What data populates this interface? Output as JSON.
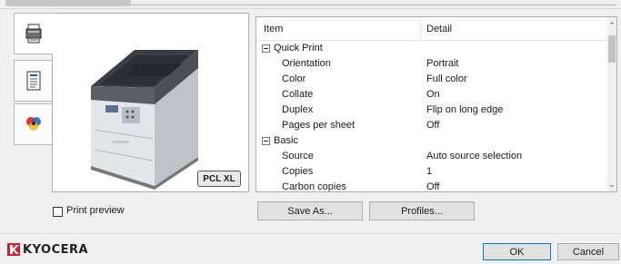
{
  "list": {
    "header_item": "Item",
    "header_detail": "Detail",
    "rows": [
      {
        "item": "Quick Print",
        "detail": "",
        "group": true
      },
      {
        "item": "Orientation",
        "detail": "Portrait"
      },
      {
        "item": "Color",
        "detail": "Full color"
      },
      {
        "item": "Collate",
        "detail": "On"
      },
      {
        "item": "Duplex",
        "detail": "Flip on long edge"
      },
      {
        "item": "Pages per sheet",
        "detail": "Off"
      },
      {
        "item": "Basic",
        "detail": "",
        "group": true
      },
      {
        "item": "Source",
        "detail": "Auto source selection"
      },
      {
        "item": "Copies",
        "detail": "1"
      },
      {
        "item": "Carbon copies",
        "detail": "Off"
      }
    ]
  },
  "preview": {
    "badge": "PCL XL"
  },
  "print_preview": {
    "label": "Print preview",
    "checked": false
  },
  "buttons": {
    "save_as": "Save As...",
    "profiles": "Profiles...",
    "ok": "OK",
    "cancel": "Cancel"
  },
  "brand": {
    "name": "KYOCERA",
    "color": "#d2202f"
  },
  "side_tabs": [
    {
      "icon": "printer-icon",
      "active": true
    },
    {
      "icon": "document-icon",
      "active": false
    },
    {
      "icon": "color-icon",
      "active": false
    }
  ]
}
